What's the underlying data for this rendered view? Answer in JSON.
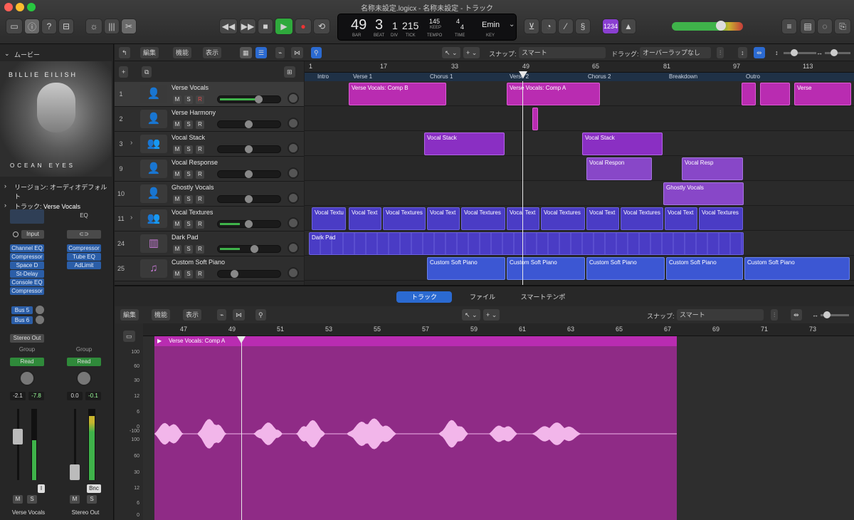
{
  "window": {
    "title": "名称未設定.logicx - 名称未設定 - トラック"
  },
  "lcd": {
    "bar": "49",
    "beat": "3",
    "div": "1",
    "tick": "215",
    "tempo": "145",
    "keep": "KEEP",
    "sig_top": "4",
    "sig_bottom": "4",
    "key": "Emin",
    "labels": {
      "bar": "BAR",
      "beat": "BEAT",
      "div": "DIV",
      "tick": "TICK",
      "tempo": "TEMPO",
      "time": "TIME",
      "key": "KEY"
    }
  },
  "toolbar": {
    "count_in_badge": "1234"
  },
  "inspector": {
    "section_movie": "ムービー",
    "art": {
      "artist": "BILLIE EILISH",
      "album": "OCEAN EYES"
    },
    "region_label": "リージョン: オーディオデフォルト",
    "track_label_prefix": "トラック: ",
    "track_label_name": "Verse Vocals",
    "strip1": {
      "input_label": "Input",
      "plugins": [
        "Channel EQ",
        "Compressor",
        "Space D",
        "St-Delay",
        "Console EQ",
        "Compressor"
      ],
      "sends": [
        "Bus 5",
        "Bus 6"
      ],
      "output": "Stereo Out",
      "group": "Group",
      "automation": "Read",
      "pan_val": "-2.1",
      "peak_val": "-7.8",
      "name": "Verse Vocals",
      "m": "M",
      "s": "S",
      "i": "I"
    },
    "strip2": {
      "eq": "EQ",
      "plugins": [
        "Compressor",
        "Tube EQ",
        "AdLimit"
      ],
      "group": "Group",
      "automation": "Read",
      "pan_val": "0.0",
      "peak_val": "-0.1",
      "name": "Stereo Out",
      "m": "M",
      "s": "S",
      "bnc": "Bnc"
    }
  },
  "trackbar": {
    "edit": "編集",
    "functions": "機能",
    "view": "表示",
    "snap_label": "スナップ:",
    "snap_value": "スマート",
    "drag_label": "ドラッグ:",
    "drag_value": "オーバーラップなし"
  },
  "tracks": [
    {
      "num": "1",
      "name": "Verse Vocals",
      "m": "M",
      "s": "S",
      "r": "R"
    },
    {
      "num": "2",
      "name": "Verse Harmony",
      "m": "M",
      "s": "S",
      "r": "R"
    },
    {
      "num": "3",
      "name": "Vocal Stack",
      "m": "M",
      "s": "S",
      "r": "R"
    },
    {
      "num": "9",
      "name": "Vocal Response",
      "m": "M",
      "s": "S",
      "r": "R"
    },
    {
      "num": "10",
      "name": "Ghostly Vocals",
      "m": "M",
      "s": "S",
      "r": "R"
    },
    {
      "num": "11",
      "name": "Vocal Textures",
      "m": "M",
      "s": "S",
      "r": "R"
    },
    {
      "num": "24",
      "name": "Dark Pad",
      "m": "M",
      "s": "S",
      "r": "R"
    },
    {
      "num": "25",
      "name": "Custom Soft Piano",
      "m": "M",
      "s": "S",
      "r": "R"
    }
  ],
  "ruler": {
    "bars": [
      "1",
      "17",
      "33",
      "49",
      "65",
      "81",
      "97",
      "113"
    ]
  },
  "markers": [
    "Intro",
    "Verse 1",
    "Chorus 1",
    "Verse 2",
    "Chorus 2",
    "Breakdown",
    "Outro"
  ],
  "regions": {
    "comp_b": "Verse Vocals: Comp B",
    "comp_a": "Verse Vocals: Comp A",
    "verse_short": "Verse",
    "vocal_stack": "Vocal Stack",
    "vocal_response": "Vocal Respon",
    "vocal_resp2": "Vocal Resp",
    "ghostly": "Ghostly Vocals",
    "textures": [
      "Vocal Textu",
      "Vocal Text",
      "Vocal Textures",
      "Vocal Text",
      "Vocal Textures",
      "Vocal Text",
      "Vocal Textures",
      "Vocal Text",
      "Vocal Textures",
      "Vocal Text",
      "Vocal Textures"
    ],
    "dark_pad": "Dark Pad",
    "piano": "Custom Soft Piano"
  },
  "editor": {
    "tabs": [
      "トラック",
      "ファイル",
      "スマートテンポ"
    ],
    "edit": "編集",
    "functions": "機能",
    "view": "表示",
    "snap_label": "スナップ:",
    "snap_value": "スマート",
    "bars": [
      "47",
      "49",
      "51",
      "53",
      "55",
      "57",
      "59",
      "61",
      "63",
      "65",
      "67",
      "69",
      "71",
      "73"
    ],
    "region_name": "Verse Vocals: Comp A",
    "scale": [
      "100",
      "60",
      "30",
      "12",
      "6",
      "0",
      "-100",
      "100",
      "60",
      "30",
      "12",
      "6",
      "0",
      "-100"
    ]
  },
  "colors": {
    "region_pink": "#b92cb1",
    "region_blue": "#3c57d3",
    "accent": "#2b6ad1"
  }
}
